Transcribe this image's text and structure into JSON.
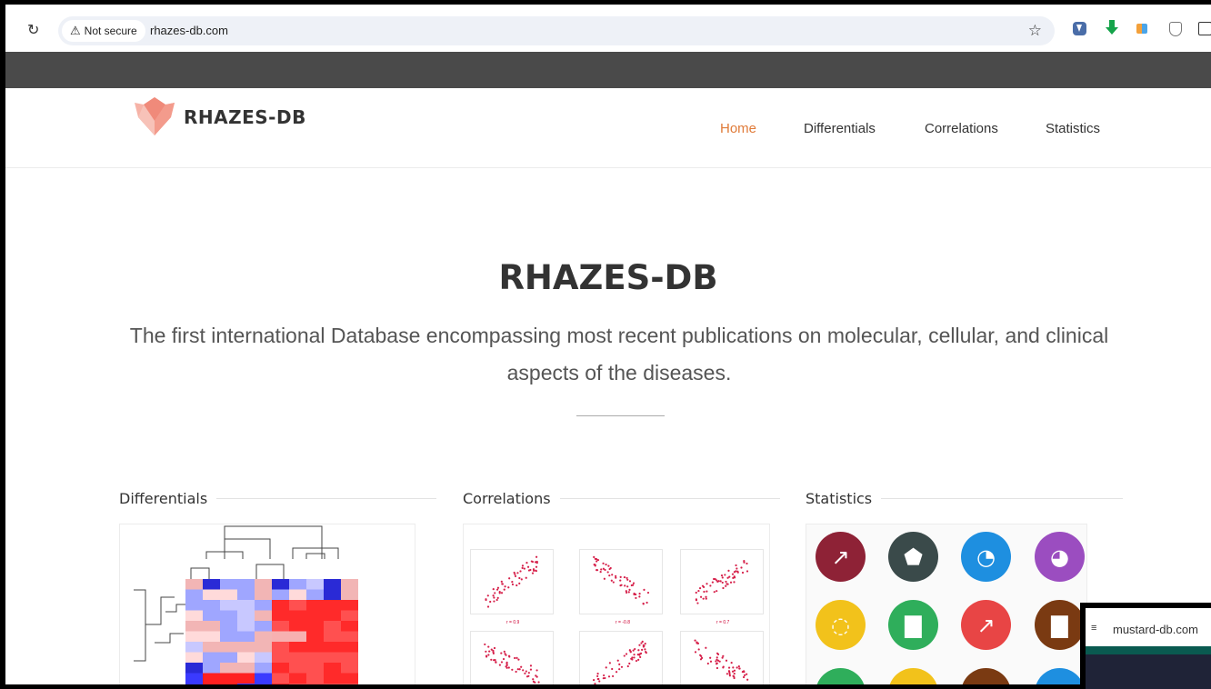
{
  "browser": {
    "security_label": "Not secure",
    "url": "rhazes-db.com"
  },
  "site": {
    "logo_text": "RHAZES-DB",
    "nav": [
      {
        "label": "Home",
        "active": true
      },
      {
        "label": "Differentials",
        "active": false
      },
      {
        "label": "Correlations",
        "active": false
      },
      {
        "label": "Statistics",
        "active": false
      }
    ],
    "accent_color": "#e07b39"
  },
  "hero": {
    "title": "RHAZES-DB",
    "subtitle": "The first international Database encompassing most recent publications on molecular, cellular, and clinical aspects of the diseases."
  },
  "sections": [
    {
      "title": "Differentials",
      "image": "heatmap-dendrogram-image"
    },
    {
      "title": "Correlations",
      "image": "scatter-plots-image"
    },
    {
      "title": "Statistics",
      "image": "statistics-icons-grid-image"
    }
  ],
  "correlation_labels": [
    "r = 0.9",
    "r = -0.8",
    "r = 0.7"
  ],
  "popup_tab": {
    "url": "mustard-db.com"
  }
}
